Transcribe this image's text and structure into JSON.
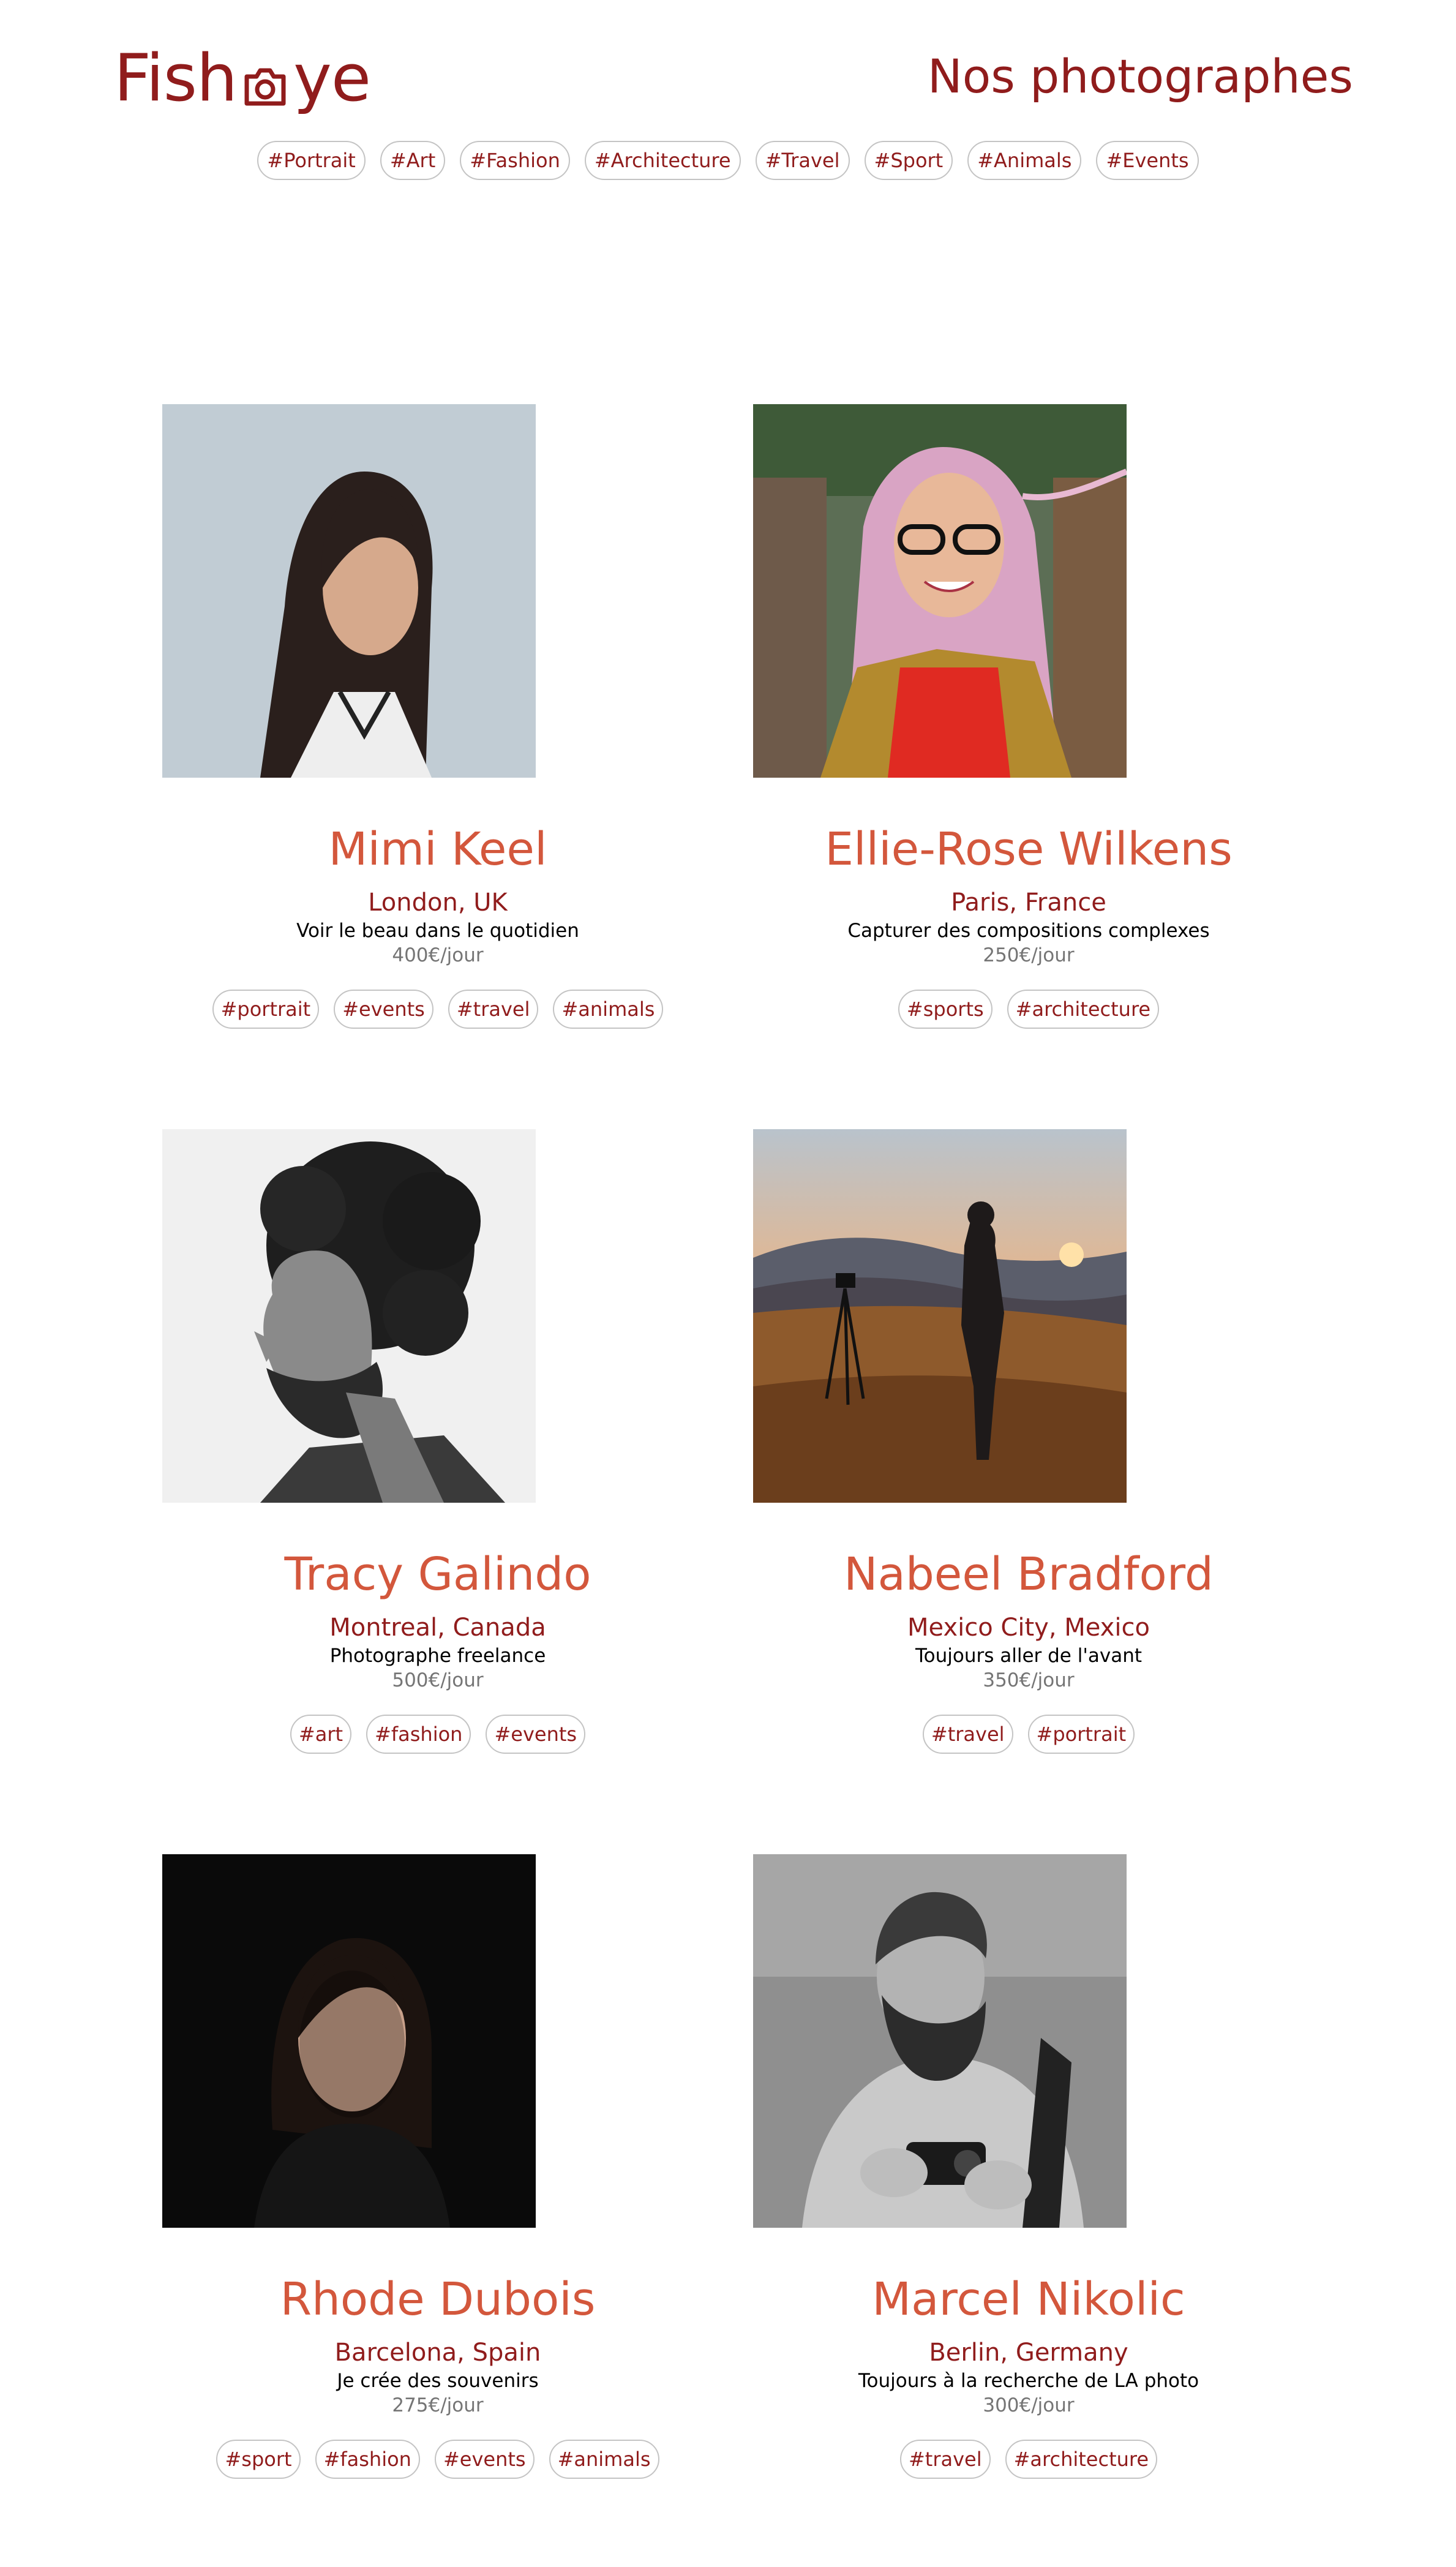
{
  "header": {
    "logo_left": "Fish",
    "logo_icon": "camera-icon",
    "logo_right": "ye",
    "title": "Nos photographes"
  },
  "nav_tags": [
    "#Portrait",
    "#Art",
    "#Fashion",
    "#Architecture",
    "#Travel",
    "#Sport",
    "#Animals",
    "#Events"
  ],
  "colors": {
    "brand": "#901C1C",
    "name": "#D3573C",
    "price": "#757575",
    "tag_border": "#C4C4C4"
  },
  "photographers": [
    {
      "name": "Mimi Keel",
      "location": "London, UK",
      "tagline": "Voir le beau dans le quotidien",
      "price": "400€/jour",
      "tags": [
        "#portrait",
        "#events",
        "#travel",
        "#animals"
      ]
    },
    {
      "name": "Ellie-Rose Wilkens",
      "location": "Paris, France",
      "tagline": "Capturer des compositions complexes",
      "price": "250€/jour",
      "tags": [
        "#sports",
        "#architecture"
      ]
    },
    {
      "name": "Tracy Galindo",
      "location": "Montreal, Canada",
      "tagline": "Photographe freelance",
      "price": "500€/jour",
      "tags": [
        "#art",
        "#fashion",
        "#events"
      ]
    },
    {
      "name": "Nabeel Bradford",
      "location": "Mexico City, Mexico",
      "tagline": "Toujours aller de l'avant",
      "price": "350€/jour",
      "tags": [
        "#travel",
        "#portrait"
      ]
    },
    {
      "name": "Rhode Dubois",
      "location": "Barcelona, Spain",
      "tagline": "Je crée des souvenirs",
      "price": "275€/jour",
      "tags": [
        "#sport",
        "#fashion",
        "#events",
        "#animals"
      ]
    },
    {
      "name": "Marcel Nikolic",
      "location": "Berlin, Germany",
      "tagline": "Toujours à la recherche de LA photo",
      "price": "300€/jour",
      "tags": [
        "#travel",
        "#architecture"
      ]
    }
  ]
}
